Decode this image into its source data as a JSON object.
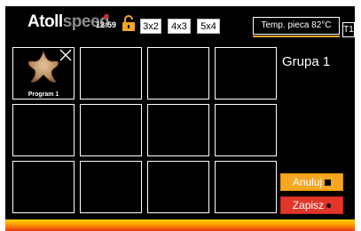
{
  "header": {
    "logo_part1": "Atoll",
    "logo_part2": "speed",
    "clock": "12:59",
    "lock_icon": "lock-open-icon",
    "grid_options": [
      "3x2",
      "4x3",
      "5x4"
    ],
    "temperature_label": "Temp. pieca 82°C",
    "oven_tab": "T1"
  },
  "grid": {
    "slots": [
      {
        "label": "Program 1",
        "has_image": true,
        "image_icon": "dough-star-icon"
      },
      {
        "label": ""
      },
      {
        "label": ""
      },
      {
        "label": ""
      },
      {
        "label": ""
      },
      {
        "label": ""
      },
      {
        "label": ""
      },
      {
        "label": ""
      },
      {
        "label": ""
      },
      {
        "label": ""
      },
      {
        "label": ""
      },
      {
        "label": ""
      }
    ]
  },
  "side": {
    "group_name": "Grupa 1",
    "cancel_label": "Anuluj",
    "save_label": "Zapisz"
  },
  "colors": {
    "accent_orange": "#f5a623",
    "accent_red": "#e2362b"
  }
}
